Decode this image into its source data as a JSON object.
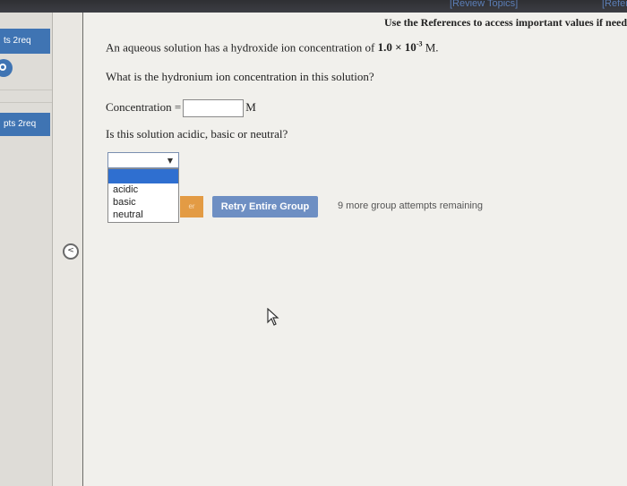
{
  "top": {
    "review_topics": "[Review Topics]",
    "references_link": "[Referen"
  },
  "sidebar": {
    "item1_label": "ts 2req",
    "item2_label": "pts 2req"
  },
  "question": {
    "references_note": "Use the References to access important values if needed f",
    "prompt_prefix": "An aqueous solution has a hydroxide ion concentration of",
    "value_mantissa": "1.0 × 10",
    "value_exponent": "-3",
    "value_unit": "M.",
    "hydronium_question": "What is the hydronium ion concentration in this solution?",
    "concentration_label": "Concentration =",
    "concentration_value": "",
    "concentration_unit": "M",
    "acidity_question": "Is this solution acidic, basic or neutral?"
  },
  "dropdown": {
    "selected": "",
    "options": [
      "acidic",
      "basic",
      "neutral"
    ]
  },
  "actions": {
    "submit_label": "er",
    "retry_label": "Retry Entire Group",
    "attempts_remaining": "9 more group attempts remaining"
  },
  "icons": {
    "collapse": "chevron-left-icon",
    "cursor": "pointer-cursor-icon"
  },
  "colors": {
    "accent_blue": "#3f74b3",
    "retry_button": "#6e8fc3",
    "submit_button": "#e39b44",
    "selection_blue": "#2f6fd0"
  }
}
